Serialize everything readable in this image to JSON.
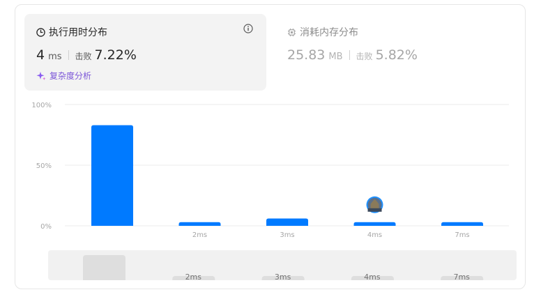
{
  "runtime": {
    "title": "执行用时分布",
    "value": "4",
    "unit": "ms",
    "beat_label": "击败",
    "beat_value": "7.22%",
    "analysis_label": "复杂度分析"
  },
  "memory": {
    "title": "消耗内存分布",
    "value": "25.83",
    "unit": "MB",
    "beat_label": "击败",
    "beat_value": "5.82%"
  },
  "colors": {
    "accent": "#007aff",
    "analysis": "#7b55d8"
  },
  "icons": {
    "runtime": "clock-icon",
    "memory": "chip-icon",
    "info": "info-icon",
    "analysis": "sparkle-icon",
    "user": "avatar"
  },
  "chart_data": {
    "type": "bar",
    "y_ticks": [
      "100%",
      "50%",
      "0%"
    ],
    "ylim": [
      0,
      100
    ],
    "categories": [
      "",
      "2ms",
      "3ms",
      "4ms",
      "7ms"
    ],
    "values": [
      83,
      3,
      6,
      3,
      3
    ],
    "highlight_category": "4ms",
    "brush": {
      "categories": [
        "",
        "2ms",
        "3ms",
        "4ms",
        "7ms"
      ],
      "values": [
        83,
        3,
        6,
        3,
        3
      ]
    }
  }
}
